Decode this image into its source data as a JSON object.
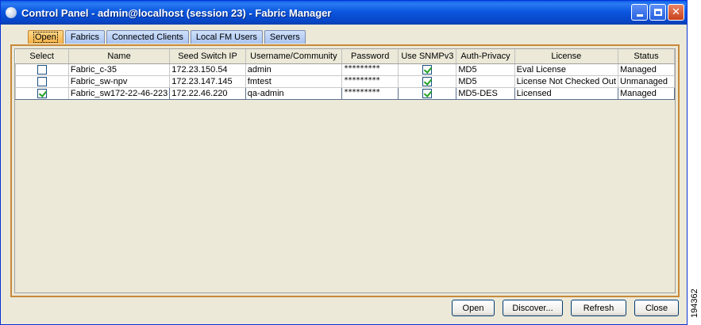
{
  "window": {
    "title": "Control Panel - admin@localhost (session 23) - Fabric Manager"
  },
  "tabs": [
    "Open",
    "Fabrics",
    "Connected Clients",
    "Local FM Users",
    "Servers"
  ],
  "table": {
    "columns": [
      "Select",
      "Name",
      "Seed Switch IP",
      "Username/Community",
      "Password",
      "Use SNMPv3",
      "Auth-Privacy",
      "License",
      "Status"
    ],
    "rows": [
      {
        "select": false,
        "name": "Fabric_c-35",
        "ip": "172.23.150.54",
        "user": "admin",
        "password": "*********",
        "snmpv3": true,
        "auth": "MD5",
        "license": "Eval License",
        "status": "Managed"
      },
      {
        "select": false,
        "name": "Fabric_sw-npv",
        "ip": "172.23.147.145",
        "user": "fmtest",
        "password": "*********",
        "snmpv3": true,
        "auth": "MD5",
        "license": "License Not Checked Out",
        "status": "Unmanaged"
      },
      {
        "select": true,
        "name": "Fabric_sw172-22-46-223",
        "ip": "172.22.46.220",
        "user": "qa-admin",
        "password": "*********",
        "snmpv3": true,
        "auth": "MD5-DES",
        "license": "Licensed",
        "status": "Managed"
      }
    ]
  },
  "buttons": {
    "open": "Open",
    "discover": "Discover...",
    "refresh": "Refresh",
    "close": "Close"
  },
  "figure_id": "194362"
}
